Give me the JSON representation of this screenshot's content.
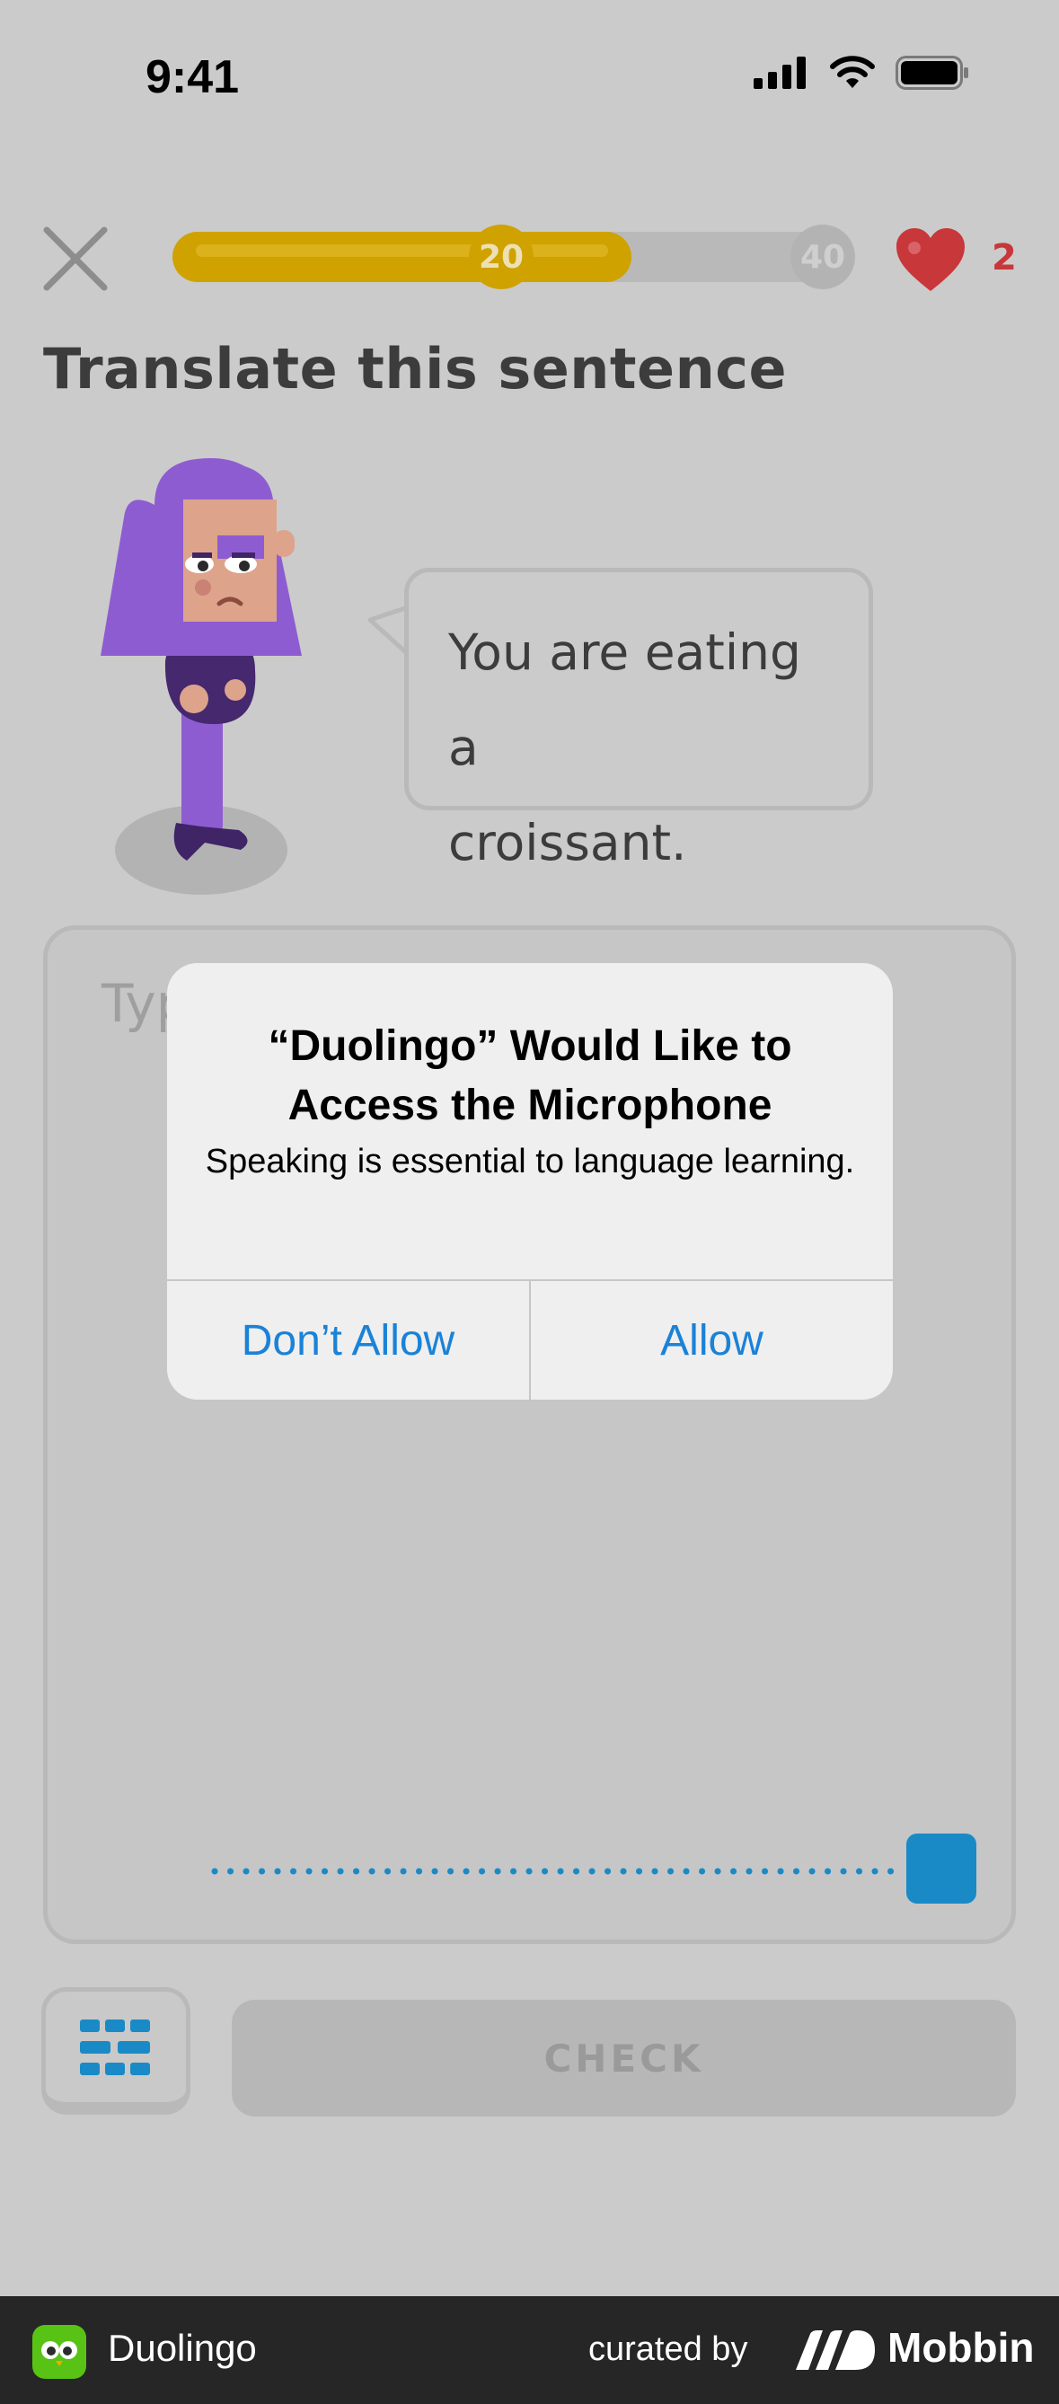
{
  "status_bar": {
    "time": "9:41"
  },
  "header": {
    "milestones": [
      "20",
      "40"
    ],
    "progress": 0.68,
    "hearts": "2"
  },
  "exercise": {
    "title": "Translate this sentence",
    "prompt_line1": "You are eating a",
    "prompt_line2": "croissant.",
    "input_placeholder": "Type",
    "check_label": "CHECK"
  },
  "alert": {
    "title": "“Duolingo” Would Like to Access the Microphone",
    "message": "Speaking is essential to language learning.",
    "deny_label": "Don’t Allow",
    "allow_label": "Allow"
  },
  "footer": {
    "app_name": "Duolingo",
    "curated_by": "curated by",
    "brand": "Mobbin"
  },
  "colors": {
    "accent_blue": "#1a82d8",
    "progress_gold": "#d0a200",
    "heart_red": "#c8373a",
    "character_purple": "#8e5cd1"
  }
}
